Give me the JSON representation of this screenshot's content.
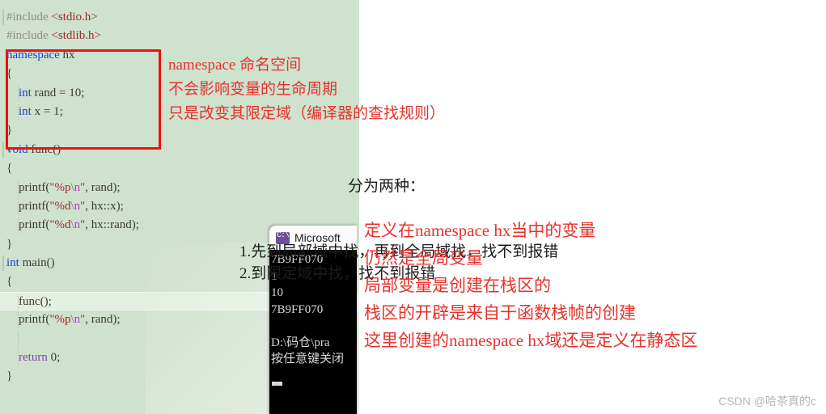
{
  "colors": {
    "editor_background": "#cfe2ce",
    "highlight_box": "#ee1111",
    "annotation_red": "#e8322c",
    "annotation_dark": "#1c1c1c",
    "keyword_blue": "#2244cc",
    "keyword_purple": "#8c3fb4",
    "string_red": "#9e2a2a",
    "escape_magenta": "#b83fc0",
    "preproc_gray": "#909080",
    "console_background": "#000000",
    "console_text": "#d9d9d9",
    "watermark": "#b5b5b5"
  },
  "editor": {
    "code_lines": [
      {
        "indent": 0,
        "bar": true,
        "guide": false,
        "highlight": false,
        "tokens": [
          {
            "t": "#include ",
            "c": "k-gray"
          },
          {
            "t": "<stdio.h>",
            "c": "k-inc"
          }
        ]
      },
      {
        "indent": 0,
        "bar": false,
        "guide": false,
        "highlight": false,
        "tokens": [
          {
            "t": "#include ",
            "c": "k-gray"
          },
          {
            "t": "<stdlib.h>",
            "c": "k-inc"
          }
        ]
      },
      {
        "indent": 0,
        "bar": false,
        "guide": false,
        "highlight": false,
        "tokens": [
          {
            "t": "namespace",
            "c": "k-blue"
          },
          {
            "t": " hx",
            "c": "k-plain"
          }
        ]
      },
      {
        "indent": 0,
        "bar": false,
        "guide": false,
        "highlight": false,
        "tokens": [
          {
            "t": "{",
            "c": "k-plain"
          }
        ]
      },
      {
        "indent": 0,
        "bar": false,
        "guide": true,
        "highlight": false,
        "tokens": [
          {
            "t": "    ",
            "c": "k-plain"
          },
          {
            "t": "int",
            "c": "k-blue"
          },
          {
            "t": " rand = ",
            "c": "k-plain"
          },
          {
            "t": "10",
            "c": "k-num"
          },
          {
            "t": ";",
            "c": "k-plain"
          }
        ]
      },
      {
        "indent": 0,
        "bar": false,
        "guide": true,
        "highlight": false,
        "tokens": [
          {
            "t": "    ",
            "c": "k-plain"
          },
          {
            "t": "int",
            "c": "k-blue"
          },
          {
            "t": " x = ",
            "c": "k-plain"
          },
          {
            "t": "1",
            "c": "k-num"
          },
          {
            "t": ";",
            "c": "k-plain"
          }
        ]
      },
      {
        "indent": 0,
        "bar": false,
        "guide": false,
        "highlight": false,
        "tokens": [
          {
            "t": "}",
            "c": "k-plain"
          }
        ]
      },
      {
        "indent": 0,
        "bar": true,
        "guide": false,
        "highlight": false,
        "tokens": [
          {
            "t": "void",
            "c": "k-blue"
          },
          {
            "t": " func()",
            "c": "k-plain"
          }
        ]
      },
      {
        "indent": 0,
        "bar": false,
        "guide": false,
        "highlight": false,
        "tokens": [
          {
            "t": "{",
            "c": "k-plain"
          }
        ]
      },
      {
        "indent": 0,
        "bar": false,
        "guide": true,
        "highlight": false,
        "tokens": [
          {
            "t": "    printf(",
            "c": "k-plain"
          },
          {
            "t": "\"%p",
            "c": "k-str"
          },
          {
            "t": "\\n",
            "c": "k-esc"
          },
          {
            "t": "\"",
            "c": "k-str"
          },
          {
            "t": ", rand);",
            "c": "k-plain"
          }
        ]
      },
      {
        "indent": 0,
        "bar": false,
        "guide": true,
        "highlight": false,
        "tokens": [
          {
            "t": "    printf(",
            "c": "k-plain"
          },
          {
            "t": "\"%d",
            "c": "k-str"
          },
          {
            "t": "\\n",
            "c": "k-esc"
          },
          {
            "t": "\"",
            "c": "k-str"
          },
          {
            "t": ", hx::x);",
            "c": "k-plain"
          }
        ]
      },
      {
        "indent": 0,
        "bar": false,
        "guide": true,
        "highlight": false,
        "tokens": [
          {
            "t": "    printf(",
            "c": "k-plain"
          },
          {
            "t": "\"%d",
            "c": "k-str"
          },
          {
            "t": "\\n",
            "c": "k-esc"
          },
          {
            "t": "\"",
            "c": "k-str"
          },
          {
            "t": ", hx::rand);",
            "c": "k-plain"
          }
        ]
      },
      {
        "indent": 0,
        "bar": false,
        "guide": false,
        "highlight": false,
        "tokens": [
          {
            "t": "}",
            "c": "k-plain"
          }
        ]
      },
      {
        "indent": 0,
        "bar": true,
        "guide": false,
        "highlight": false,
        "tokens": [
          {
            "t": "int",
            "c": "k-blue"
          },
          {
            "t": " main()",
            "c": "k-plain"
          }
        ]
      },
      {
        "indent": 0,
        "bar": false,
        "guide": false,
        "highlight": false,
        "tokens": [
          {
            "t": "{",
            "c": "k-plain"
          }
        ]
      },
      {
        "indent": 0,
        "bar": false,
        "guide": true,
        "highlight": true,
        "tokens": [
          {
            "t": "    func();",
            "c": "k-plain"
          }
        ]
      },
      {
        "indent": 0,
        "bar": false,
        "guide": true,
        "highlight": false,
        "tokens": [
          {
            "t": "    printf(",
            "c": "k-plain"
          },
          {
            "t": "\"%p",
            "c": "k-str"
          },
          {
            "t": "\\n",
            "c": "k-esc"
          },
          {
            "t": "\"",
            "c": "k-str"
          },
          {
            "t": ", rand);",
            "c": "k-plain"
          }
        ]
      },
      {
        "indent": 0,
        "bar": false,
        "guide": true,
        "highlight": false,
        "tokens": [
          {
            "t": "",
            "c": "k-plain"
          }
        ]
      },
      {
        "indent": 0,
        "bar": false,
        "guide": true,
        "highlight": false,
        "tokens": [
          {
            "t": "    ",
            "c": "k-plain"
          },
          {
            "t": "return",
            "c": "k-purple"
          },
          {
            "t": " ",
            "c": "k-plain"
          },
          {
            "t": "0",
            "c": "k-num"
          },
          {
            "t": ";",
            "c": "k-plain"
          }
        ]
      },
      {
        "indent": 0,
        "bar": false,
        "guide": false,
        "highlight": false,
        "tokens": [
          {
            "t": "}",
            "c": "k-plain"
          }
        ]
      }
    ]
  },
  "console": {
    "icon": "command-prompt-icon",
    "title": "Microsoft",
    "output_lines": [
      "7B9FF070",
      "1",
      "10",
      "7B9FF070",
      "",
      "D:\\码仓\\pra",
      "按任意键关闭"
    ]
  },
  "annotations": {
    "top": [
      "namespace 命名空间",
      "不会影响变量的生命周期",
      "只是改变其限定域（编译器的查找规则）"
    ],
    "middle_heading": "分为两种：",
    "middle_items": [
      "1.先到局部域中找，再到全局域找，找不到报错",
      "2.到限定域中找，找不到报错"
    ],
    "bottom": [
      "定义在namespace hx当中的变量",
      "仍然是全局变量",
      "局部变量是创建在栈区的",
      "栈区的开辟是来自于函数栈帧的创建",
      "这里创建的namespace hx域还是定义在静态区"
    ]
  },
  "watermark": {
    "text": "CSDN @哈茶真的c"
  }
}
